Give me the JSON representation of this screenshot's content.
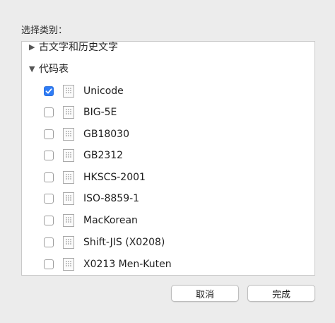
{
  "prompt_label": "选择类别：",
  "groups": {
    "top_label": "古文字和历史文字",
    "codes_label": "代码表"
  },
  "icons": {
    "collapsed": "disclosure-right-icon",
    "expanded": "disclosure-down-icon",
    "item": "character-table-icon",
    "check": "checkmark-icon"
  },
  "items": [
    {
      "label": "Unicode",
      "checked": true
    },
    {
      "label": "BIG-5E",
      "checked": false
    },
    {
      "label": "GB18030",
      "checked": false
    },
    {
      "label": "GB2312",
      "checked": false
    },
    {
      "label": "HKSCS-2001",
      "checked": false
    },
    {
      "label": "ISO-8859-1",
      "checked": false
    },
    {
      "label": "MacKorean",
      "checked": false
    },
    {
      "label": "Shift-JIS (X0208)",
      "checked": false
    },
    {
      "label": "X0213 Men-Kuten",
      "checked": false
    }
  ],
  "buttons": {
    "cancel": "取消",
    "done": "完成"
  },
  "colors": {
    "accent": "#2f7cf6"
  }
}
